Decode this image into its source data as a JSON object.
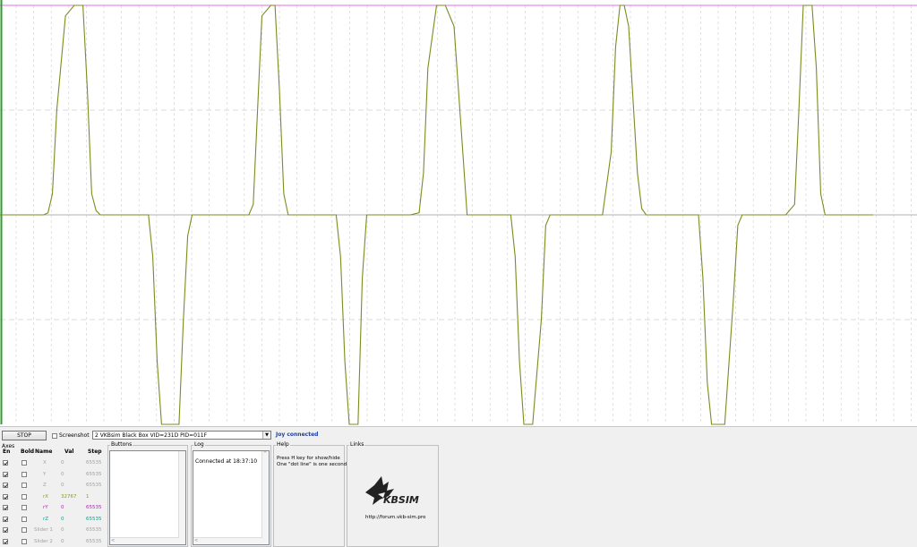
{
  "colors": {
    "signal": "#7a8c1e",
    "baseline": "#b0b0b0",
    "grid": "#cfcfcf",
    "top_line": "#e070e0",
    "left_axis": "#2aa02a"
  },
  "controls": {
    "stop_label": "STOP",
    "screenshot_label": "Screenshot",
    "device": "2 VKBsim Black Box  VID=231D PID=011F",
    "status": "Joy connected"
  },
  "axes": {
    "title": "Axes",
    "headers": {
      "en": "En",
      "bold": "Bold",
      "name": "Name",
      "val": "Val",
      "step": "Step"
    },
    "rows": [
      {
        "name": "X",
        "val": "0",
        "step": "65535",
        "en": true,
        "color": "#a0a0a0"
      },
      {
        "name": "Y",
        "val": "0",
        "step": "65535",
        "en": true,
        "color": "#a0a0a0"
      },
      {
        "name": "Z",
        "val": "0",
        "step": "65535",
        "en": true,
        "color": "#a0a0a0"
      },
      {
        "name": "rX",
        "val": "32767",
        "step": "1",
        "en": true,
        "color": "#8c9a1a"
      },
      {
        "name": "rY",
        "val": "0",
        "step": "65535",
        "en": true,
        "color": "#b01eb0"
      },
      {
        "name": "rZ",
        "val": "0",
        "step": "65535",
        "en": true,
        "color": "#1a9a8a"
      },
      {
        "name": "Slider 1",
        "val": "0",
        "step": "65535",
        "en": true,
        "color": "#a0a0a0"
      },
      {
        "name": "Slider 2",
        "val": "0",
        "step": "65535",
        "en": true,
        "color": "#a0a0a0"
      }
    ]
  },
  "buttons_panel": {
    "title": "Buttons"
  },
  "log": {
    "title": "Log",
    "text": "Connected at 18:37:10"
  },
  "help": {
    "title": "Help",
    "line1": "Press H key for show/hide",
    "line2": "One \"dot line\" is one second"
  },
  "links": {
    "title": "Links",
    "logo_text": "KBSIM",
    "url": "http://forum.vkb-sim.pro"
  },
  "icons": [
    "stop-button",
    "checkbox",
    "dropdown-arrow",
    "vkb-eagle-logo"
  ],
  "chart_data": {
    "type": "line",
    "description_series": "rX",
    "ylim": [
      -1,
      1
    ],
    "x": [
      0,
      0.05,
      0.055,
      0.06,
      0.065,
      0.075,
      0.085,
      0.095,
      0.1,
      0.105,
      0.11,
      0.115,
      0.17,
      0.175,
      0.18,
      0.185,
      0.19,
      0.195,
      0.205,
      0.21,
      0.215,
      0.22,
      0.27,
      0.285,
      0.29,
      0.295,
      0.3,
      0.31,
      0.315,
      0.32,
      0.325,
      0.33,
      0.375,
      0.385,
      0.39,
      0.395,
      0.4,
      0.405,
      0.41,
      0.415,
      0.42,
      0.47,
      0.48,
      0.485,
      0.49,
      0.5,
      0.51,
      0.52,
      0.53,
      0.535,
      0.585,
      0.59,
      0.595,
      0.6,
      0.605,
      0.61,
      0.62,
      0.625,
      0.63,
      0.635,
      0.69,
      0.7,
      0.705,
      0.71,
      0.715,
      0.72,
      0.73,
      0.735,
      0.74,
      0.75,
      0.8,
      0.805,
      0.81,
      0.815,
      0.82,
      0.83,
      0.84,
      0.845,
      0.85,
      0.86,
      0.9,
      0.91,
      0.915,
      0.92,
      0.925,
      0.93,
      0.935,
      0.94,
      0.945,
      0.95,
      1.0
    ],
    "y": [
      0,
      0,
      0.01,
      0.1,
      0.5,
      0.95,
      1,
      1,
      0.6,
      0.1,
      0.02,
      0,
      0,
      -0.2,
      -0.7,
      -1,
      -1,
      -1,
      -1,
      -0.5,
      -0.1,
      0,
      0,
      0,
      0.05,
      0.5,
      0.95,
      1,
      1,
      0.6,
      0.1,
      0,
      0,
      0,
      -0.2,
      -0.7,
      -1,
      -1,
      -1,
      -0.3,
      0,
      0,
      0.01,
      0.2,
      0.7,
      1,
      1,
      0.9,
      0.3,
      0,
      0,
      -0.2,
      -0.7,
      -1,
      -1,
      -1,
      -0.5,
      -0.05,
      0,
      0,
      0,
      0.3,
      0.8,
      1,
      1,
      0.9,
      0.2,
      0.03,
      0,
      0,
      0,
      -0.3,
      -0.8,
      -1,
      -1,
      -1,
      -0.4,
      -0.05,
      0,
      0,
      0,
      0.05,
      0.5,
      1,
      1,
      1,
      0.7,
      0.1,
      0,
      0,
      0
    ]
  }
}
